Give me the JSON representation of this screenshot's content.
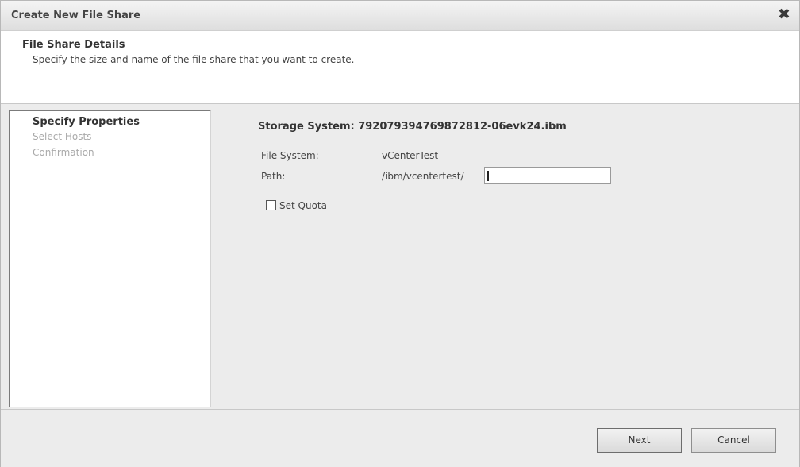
{
  "window": {
    "title": "Create New File Share",
    "close_glyph": "✖"
  },
  "header": {
    "title": "File Share Details",
    "subtitle": "Specify the size and name of the file share that you want to create."
  },
  "steps": [
    {
      "label": "Specify Properties",
      "active": true
    },
    {
      "label": "Select Hosts",
      "active": false
    },
    {
      "label": "Confirmation",
      "active": false
    }
  ],
  "form": {
    "storage_system": "Storage System: 792079394769872812-06evk24.ibm",
    "file_system_label": "File System:",
    "file_system_value": "vCenterTest",
    "path_label": "Path:",
    "path_prefix": "/ibm/vcentertest/",
    "path_value": "",
    "set_quota_label": "Set Quota",
    "set_quota_checked": false
  },
  "buttons": {
    "next": "Next",
    "cancel": "Cancel"
  }
}
